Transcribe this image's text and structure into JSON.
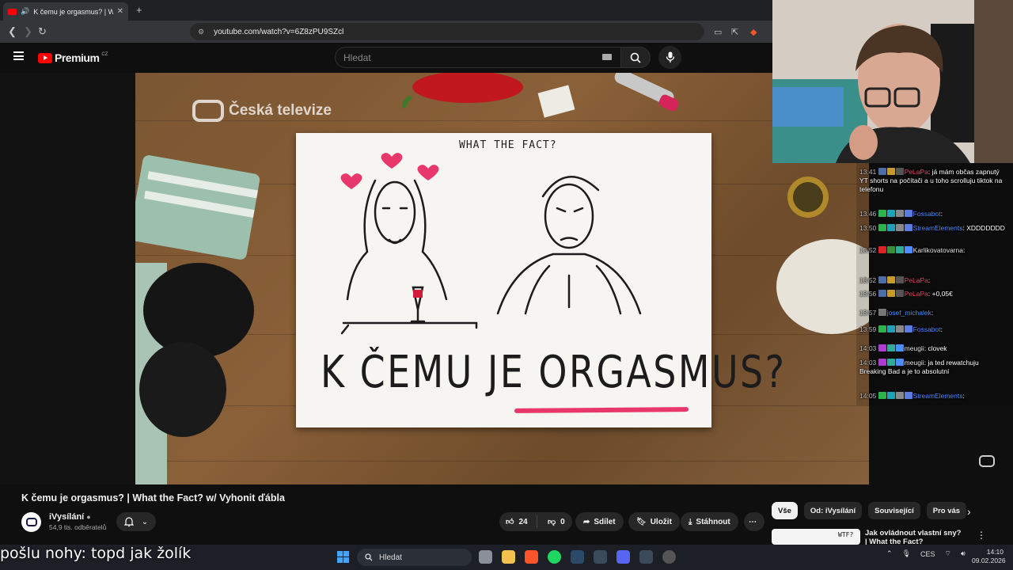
{
  "browser": {
    "tab_title": "K čemu je orgasmus? | What the",
    "new_tab": "+",
    "url": "youtube.com/watch?v=6Z8zPU9SZcl"
  },
  "youtube": {
    "logo_text": "Premium",
    "region": "CZ",
    "search_placeholder": "Hledat"
  },
  "video": {
    "thumbnail": {
      "broadcaster": "Česká televize",
      "card_top": "WHAT THE FACT?",
      "card_title_a": "K ČEMU JE ",
      "card_title_b": "ORGASMUS",
      "card_title_c": "?"
    },
    "title": "K čemu je orgasmus? | What the Fact? w/ Vyhonit ďábla",
    "channel": "iVysílání",
    "subscribers": "54,9 tis. odběratelů",
    "likes": "24",
    "dislikes": "0",
    "actions": {
      "share": "Sdílet",
      "save": "Uložit",
      "download": "Stáhnout",
      "more": "⋯"
    }
  },
  "chips": [
    "Vše",
    "Od: iVysílání",
    "Související",
    "Pro vás"
  ],
  "recommendation": {
    "title": "Jak ovládnout vlastní sny? | What the Fact?",
    "thumb_text": "WTF?"
  },
  "chat": [
    {
      "time": "13:41",
      "name": "PeLaPa",
      "name_color": "#ff3b6b",
      "text": "já mám občas zapnutý YT shorts na počítači a u toho scrolluju tiktok na telefonu",
      "badges": [
        "#4b6ea8",
        "#c69b2b",
        "#555"
      ]
    },
    {
      "time": "13:46",
      "name": "Fossabot",
      "name_color": "#4d8fff",
      "text": "",
      "badges": [
        "#2cb34a",
        "#22a0b5",
        "#888",
        "#5b7de0"
      ]
    },
    {
      "time": "13:50",
      "name": "StreamElements",
      "name_color": "#4d8fff",
      "text": "XDDDDDDD",
      "badges": [
        "#2cb34a",
        "#22a0b5",
        "#888",
        "#5b7de0"
      ]
    },
    {
      "time": "13:52",
      "name": "Karlikovatovarna",
      "name_color": "#e0e0e0",
      "text": "",
      "badges": [
        "#d22",
        "#3a8f3a",
        "#3a9",
        "#4d8fff"
      ]
    },
    {
      "time": "13:52",
      "name": "PeLaPa",
      "name_color": "#ff3b6b",
      "text": "",
      "badges": [
        "#4b6ea8",
        "#c69b2b",
        "#555"
      ]
    },
    {
      "time": "13:56",
      "name": "PeLaPa",
      "name_color": "#ff3b6b",
      "text": "+0,05€",
      "badges": [
        "#4b6ea8",
        "#c69b2b",
        "#555"
      ]
    },
    {
      "time": "13:57",
      "name": "josef_michalek",
      "name_color": "#4d8fff",
      "text": "",
      "badges": [
        "#777"
      ]
    },
    {
      "time": "13:59",
      "name": "Fossabot",
      "name_color": "#4d8fff",
      "text": "",
      "badges": [
        "#2cb34a",
        "#22a0b5",
        "#888",
        "#5b7de0"
      ]
    },
    {
      "time": "14:03",
      "name": "meugii",
      "name_color": "#e0e0e0",
      "text": "clovek",
      "badges": [
        "#b03bd0",
        "#3a9",
        "#4d8fff"
      ]
    },
    {
      "time": "14:03",
      "name": "meugii",
      "name_color": "#e0e0e0",
      "text": "ja ted rewatchuju Breaking Bad a je to absolutní",
      "badges": [
        "#b03bd0",
        "#3a9",
        "#4d8fff"
      ]
    },
    {
      "time": "14:05",
      "name": "StreamElements",
      "name_color": "#4d8fff",
      "text": "",
      "badges": [
        "#2cb34a",
        "#22a0b5",
        "#888",
        "#5b7de0"
      ]
    }
  ],
  "caption": "pošlu nohy: topd jak žolík",
  "taskbar": {
    "search": "Hledat",
    "lang": "CES",
    "time": "14:10",
    "date": "09.02.2026"
  }
}
